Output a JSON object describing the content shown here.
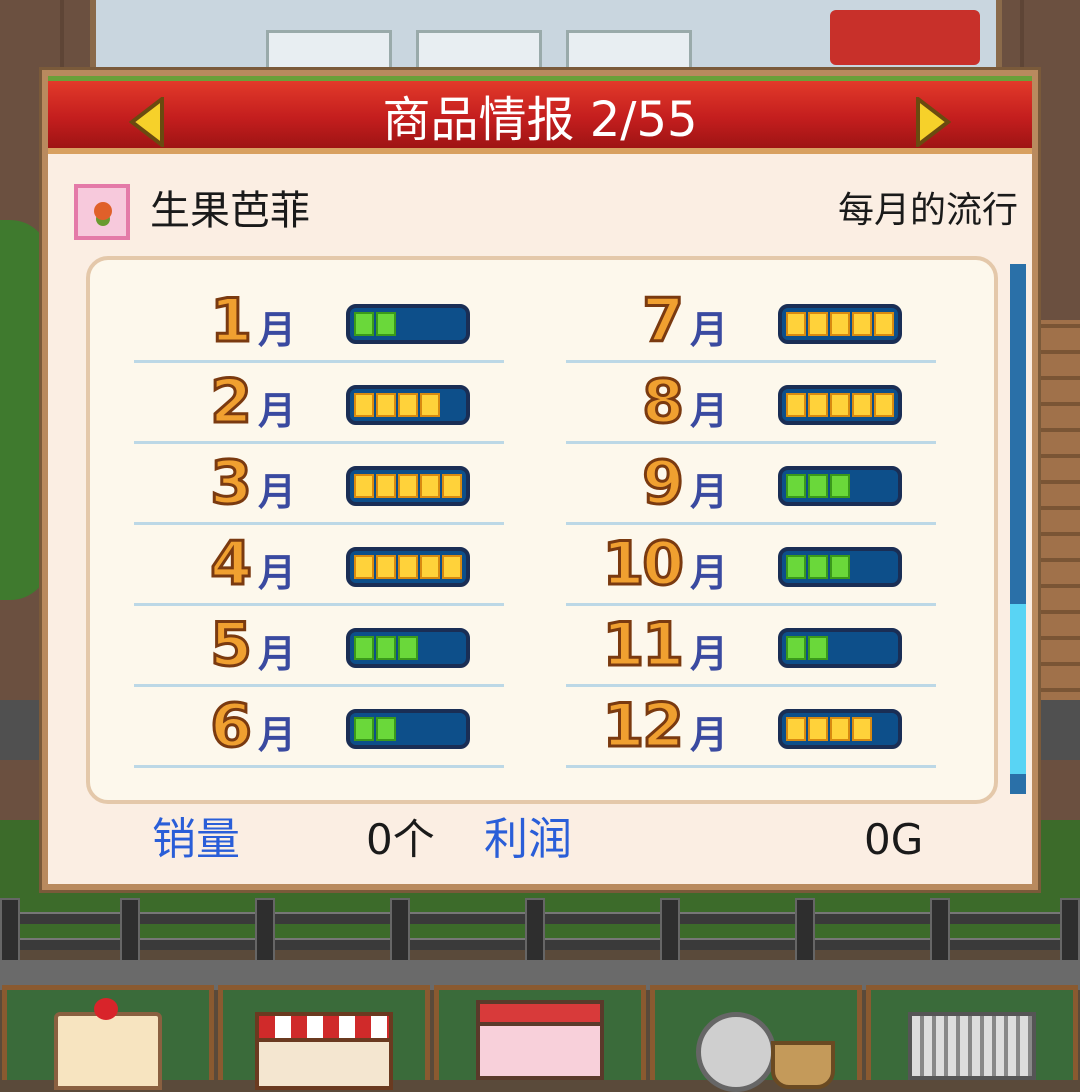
{
  "dialog": {
    "title": "商品情报 2/55",
    "product_name": "生果芭菲",
    "trend_label": "每月的流行",
    "product_icon": "fruit-parfait-icon",
    "month_unit": "月",
    "months": [
      {
        "num": "1",
        "level": 2,
        "color": "green"
      },
      {
        "num": "2",
        "level": 4,
        "color": "yellow"
      },
      {
        "num": "3",
        "level": 5,
        "color": "yellow"
      },
      {
        "num": "4",
        "level": 5,
        "color": "yellow"
      },
      {
        "num": "5",
        "level": 3,
        "color": "green"
      },
      {
        "num": "6",
        "level": 2,
        "color": "green"
      },
      {
        "num": "7",
        "level": 5,
        "color": "yellow"
      },
      {
        "num": "8",
        "level": 5,
        "color": "yellow"
      },
      {
        "num": "9",
        "level": 3,
        "color": "green"
      },
      {
        "num": "10",
        "level": 3,
        "color": "green"
      },
      {
        "num": "11",
        "level": 2,
        "color": "green"
      },
      {
        "num": "12",
        "level": 4,
        "color": "yellow"
      }
    ],
    "trend_max": 5,
    "sales_label": "销量",
    "sales_value": "0个",
    "profit_label": "利润",
    "profit_value": "0G"
  },
  "toolbar": {
    "buttons": [
      "cake-icon",
      "shop-icon",
      "store-icon",
      "gear-icon",
      "cart-icon"
    ]
  },
  "colors": {
    "title_bar": "#c41e1e",
    "dialog_bg": "#fbeee3",
    "bar_green": "#6ad83a",
    "bar_yellow": "#ffd23a",
    "label_blue": "#2a5ed8"
  }
}
